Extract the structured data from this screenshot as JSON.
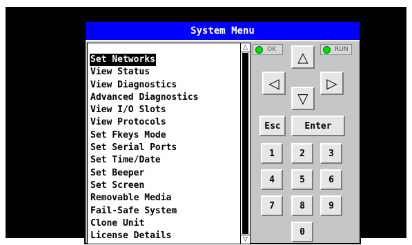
{
  "window": {
    "title": "System Menu"
  },
  "menu": {
    "items": [
      {
        "label": "Set Networks",
        "selected": true
      },
      {
        "label": "View Status"
      },
      {
        "label": "View Diagnostics"
      },
      {
        "label": "Advanced Diagnostics"
      },
      {
        "label": "View I/O Slots"
      },
      {
        "label": "View Protocols"
      },
      {
        "label": "Set Fkeys Mode"
      },
      {
        "label": "Set Serial Ports"
      },
      {
        "label": "Set Time/Date"
      },
      {
        "label": "Set Beeper"
      },
      {
        "label": "Set Screen"
      },
      {
        "label": "Removable Media"
      },
      {
        "label": "Fail-Safe System"
      },
      {
        "label": "Clone Unit"
      },
      {
        "label": "License Details"
      }
    ],
    "scroll_up_glyph": "△",
    "scroll_down_glyph": "▽"
  },
  "indicators": {
    "ok_label": "OK",
    "run_label": "RUN",
    "led_color": "#00e000"
  },
  "keys": {
    "up": "△",
    "left": "◁",
    "right": "▷",
    "down": "▽",
    "esc": "Esc",
    "enter": "Enter",
    "k1": "1",
    "k2": "2",
    "k3": "3",
    "k4": "4",
    "k5": "5",
    "k6": "6",
    "k7": "7",
    "k8": "8",
    "k9": "9",
    "k0": "0"
  },
  "colors": {
    "title_bar": "#0000ff",
    "panel": "#c6c6c6",
    "screen": "#000000"
  }
}
